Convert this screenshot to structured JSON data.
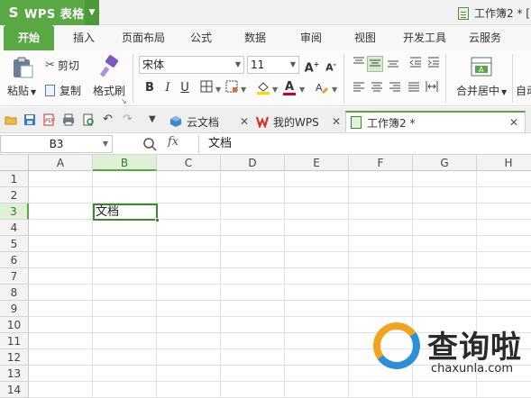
{
  "app": {
    "name": "WPS 表格",
    "logo_char": "S",
    "dropdown_glyph": "▼",
    "document_title": "工作簿2 * ["
  },
  "menu": {
    "tabs": [
      "开始",
      "插入",
      "页面布局",
      "公式",
      "数据",
      "审阅",
      "视图",
      "开发工具",
      "云服务"
    ],
    "active": "开始"
  },
  "ribbon": {
    "paste_label": "粘贴",
    "cut_label": "剪切",
    "copy_label": "复制",
    "format_painter_label": "格式刷",
    "font_name": "宋体",
    "font_size": "11",
    "bold": "B",
    "italic": "I",
    "underline": "U",
    "merge_center_label": "合并居中",
    "auto_label": "自动",
    "font_color": "#d0021b",
    "fill_color": "#ffd400"
  },
  "doc_tabs": [
    {
      "label": "云文档",
      "icon": "cloud-icon"
    },
    {
      "label": "我的WPS",
      "icon": "wps-logo-icon"
    },
    {
      "label": "工作簿2 *",
      "icon": "spreadsheet-icon",
      "active": true
    }
  ],
  "formula_bar": {
    "name_box": "B3",
    "fx": "fx",
    "content": "文档"
  },
  "sheet": {
    "columns": [
      "A",
      "B",
      "C",
      "D",
      "E",
      "F",
      "G",
      "H"
    ],
    "rows": [
      "1",
      "2",
      "3",
      "4",
      "5",
      "6",
      "7",
      "8",
      "9",
      "10",
      "11",
      "12",
      "13",
      "14"
    ],
    "selected_column": "B",
    "selected_row": "3",
    "active_cell_value": "文档"
  },
  "watermark": {
    "chinese": "查询啦",
    "english": "chaxunla.com"
  },
  "colors": {
    "accent": "#5aa843",
    "selection": "#3c8a2e"
  }
}
